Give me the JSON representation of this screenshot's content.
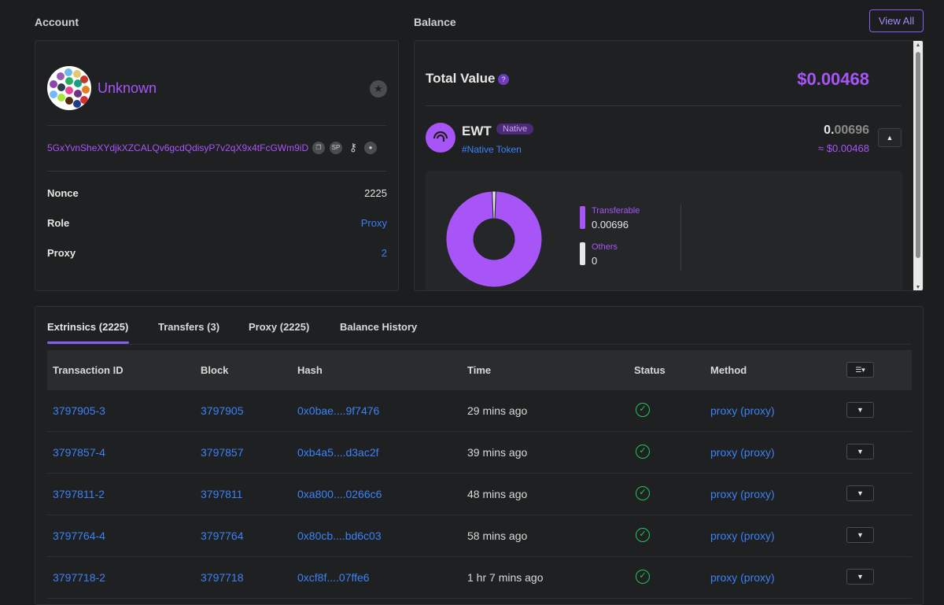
{
  "account": {
    "section_title": "Account",
    "name": "Unknown",
    "address": "5GxYvnSheXYdjkXZCALQv6gcdQdisyP7v2qX9x4tFcGWm9iD",
    "fields": [
      {
        "label": "Nonce",
        "value": "2225"
      },
      {
        "label": "Role",
        "value": "Proxy"
      },
      {
        "label": "Proxy",
        "value": "2"
      }
    ],
    "address_icons": [
      "copy-icon",
      "subscan-icon",
      "key-icon",
      "user-icon"
    ],
    "icon_glyph_copy": "❐",
    "icon_glyph_sp": "SP",
    "icon_glyph_key": "⚷",
    "icon_glyph_user": "●"
  },
  "balance": {
    "section_title": "Balance",
    "view_all_label": "View All",
    "total_label": "Total Value",
    "total_help": "?",
    "total_value": "$0.00468",
    "token": {
      "symbol": "EWT",
      "badge": "Native",
      "subtitle": "#Native Token",
      "amount_int": "0.",
      "amount_dec": "00696",
      "usd": "≈ $0.00468",
      "collapse_glyph": "▲"
    },
    "chart_data": {
      "type": "pie",
      "labels": [
        "Transferable",
        "Others"
      ],
      "values": [
        0.00696,
        0
      ],
      "display_values": [
        "0.00696",
        "0"
      ],
      "colors": [
        "#a855f7",
        "#e5e7eb"
      ]
    }
  },
  "tabs": [
    {
      "label": "Extrinsics (2225)",
      "active": true
    },
    {
      "label": "Transfers (3)",
      "active": false
    },
    {
      "label": "Proxy (2225)",
      "active": false
    },
    {
      "label": "Balance History",
      "active": false
    }
  ],
  "table": {
    "columns": [
      "Transaction ID",
      "Block",
      "Hash",
      "Time",
      "Status",
      "Method"
    ],
    "column_toggle_glyph": "☰▾",
    "row_toggle_glyph": "▼",
    "status_glyph": "✓",
    "rows": [
      {
        "id": "3797905-3",
        "block": "3797905",
        "hash": "0x0bae....9f7476",
        "time": "29 mins ago",
        "method": "proxy (proxy)"
      },
      {
        "id": "3797857-4",
        "block": "3797857",
        "hash": "0xb4a5....d3ac2f",
        "time": "39 mins ago",
        "method": "proxy (proxy)"
      },
      {
        "id": "3797811-2",
        "block": "3797811",
        "hash": "0xa800....0266c6",
        "time": "48 mins ago",
        "method": "proxy (proxy)"
      },
      {
        "id": "3797764-4",
        "block": "3797764",
        "hash": "0x80cb....bd6c03",
        "time": "58 mins ago",
        "method": "proxy (proxy)"
      },
      {
        "id": "3797718-2",
        "block": "3797718",
        "hash": "0xcf8f....07ffe6",
        "time": "1 hr 7 mins ago",
        "method": "proxy (proxy)"
      }
    ]
  },
  "colors": {
    "accent": "#a855f7",
    "link": "#3c82f6",
    "success": "#22c55e",
    "background": "#1b1d1e"
  }
}
